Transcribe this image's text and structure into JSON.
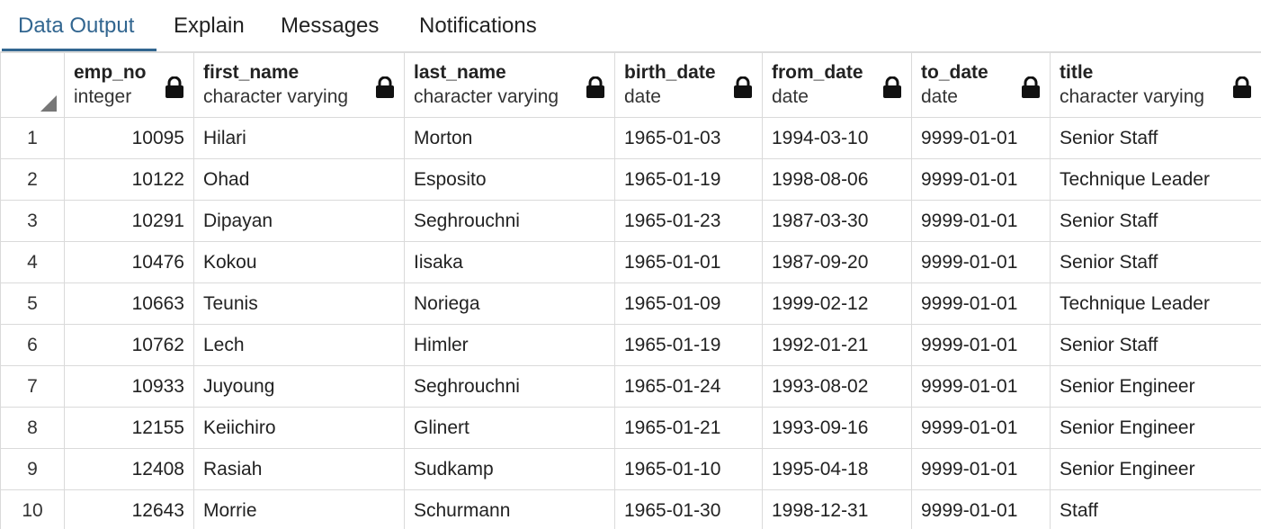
{
  "tabs": [
    {
      "label": "Data Output",
      "active": true
    },
    {
      "label": "Explain",
      "active": false
    },
    {
      "label": "Messages",
      "active": false
    },
    {
      "label": "Notifications",
      "active": false
    }
  ],
  "columns": [
    {
      "name": "emp_no",
      "type": "integer",
      "locked": true
    },
    {
      "name": "first_name",
      "type": "character varying",
      "locked": true
    },
    {
      "name": "last_name",
      "type": "character varying",
      "locked": true
    },
    {
      "name": "birth_date",
      "type": "date",
      "locked": true
    },
    {
      "name": "from_date",
      "type": "date",
      "locked": true
    },
    {
      "name": "to_date",
      "type": "date",
      "locked": true
    },
    {
      "name": "title",
      "type": "character varying",
      "locked": true
    }
  ],
  "rows": [
    {
      "n": "1",
      "cells": [
        "10095",
        "Hilari",
        "Morton",
        "1965-01-03",
        "1994-03-10",
        "9999-01-01",
        "Senior Staff"
      ]
    },
    {
      "n": "2",
      "cells": [
        "10122",
        "Ohad",
        "Esposito",
        "1965-01-19",
        "1998-08-06",
        "9999-01-01",
        "Technique Leader"
      ]
    },
    {
      "n": "3",
      "cells": [
        "10291",
        "Dipayan",
        "Seghrouchni",
        "1965-01-23",
        "1987-03-30",
        "9999-01-01",
        "Senior Staff"
      ]
    },
    {
      "n": "4",
      "cells": [
        "10476",
        "Kokou",
        "Iisaka",
        "1965-01-01",
        "1987-09-20",
        "9999-01-01",
        "Senior Staff"
      ]
    },
    {
      "n": "5",
      "cells": [
        "10663",
        "Teunis",
        "Noriega",
        "1965-01-09",
        "1999-02-12",
        "9999-01-01",
        "Technique Leader"
      ]
    },
    {
      "n": "6",
      "cells": [
        "10762",
        "Lech",
        "Himler",
        "1965-01-19",
        "1992-01-21",
        "9999-01-01",
        "Senior Staff"
      ]
    },
    {
      "n": "7",
      "cells": [
        "10933",
        "Juyoung",
        "Seghrouchni",
        "1965-01-24",
        "1993-08-02",
        "9999-01-01",
        "Senior Engineer"
      ]
    },
    {
      "n": "8",
      "cells": [
        "12155",
        "Keiichiro",
        "Glinert",
        "1965-01-21",
        "1993-09-16",
        "9999-01-01",
        "Senior Engineer"
      ]
    },
    {
      "n": "9",
      "cells": [
        "12408",
        "Rasiah",
        "Sudkamp",
        "1965-01-10",
        "1995-04-18",
        "9999-01-01",
        "Senior Engineer"
      ]
    },
    {
      "n": "10",
      "cells": [
        "12643",
        "Morrie",
        "Schurmann",
        "1965-01-30",
        "1998-12-31",
        "9999-01-01",
        "Staff"
      ]
    }
  ],
  "icons": {
    "lock": "lock-icon",
    "sort_corner": "sort-corner-icon"
  },
  "colors": {
    "active_tab": "#326690",
    "grid_border": "#dadada"
  }
}
